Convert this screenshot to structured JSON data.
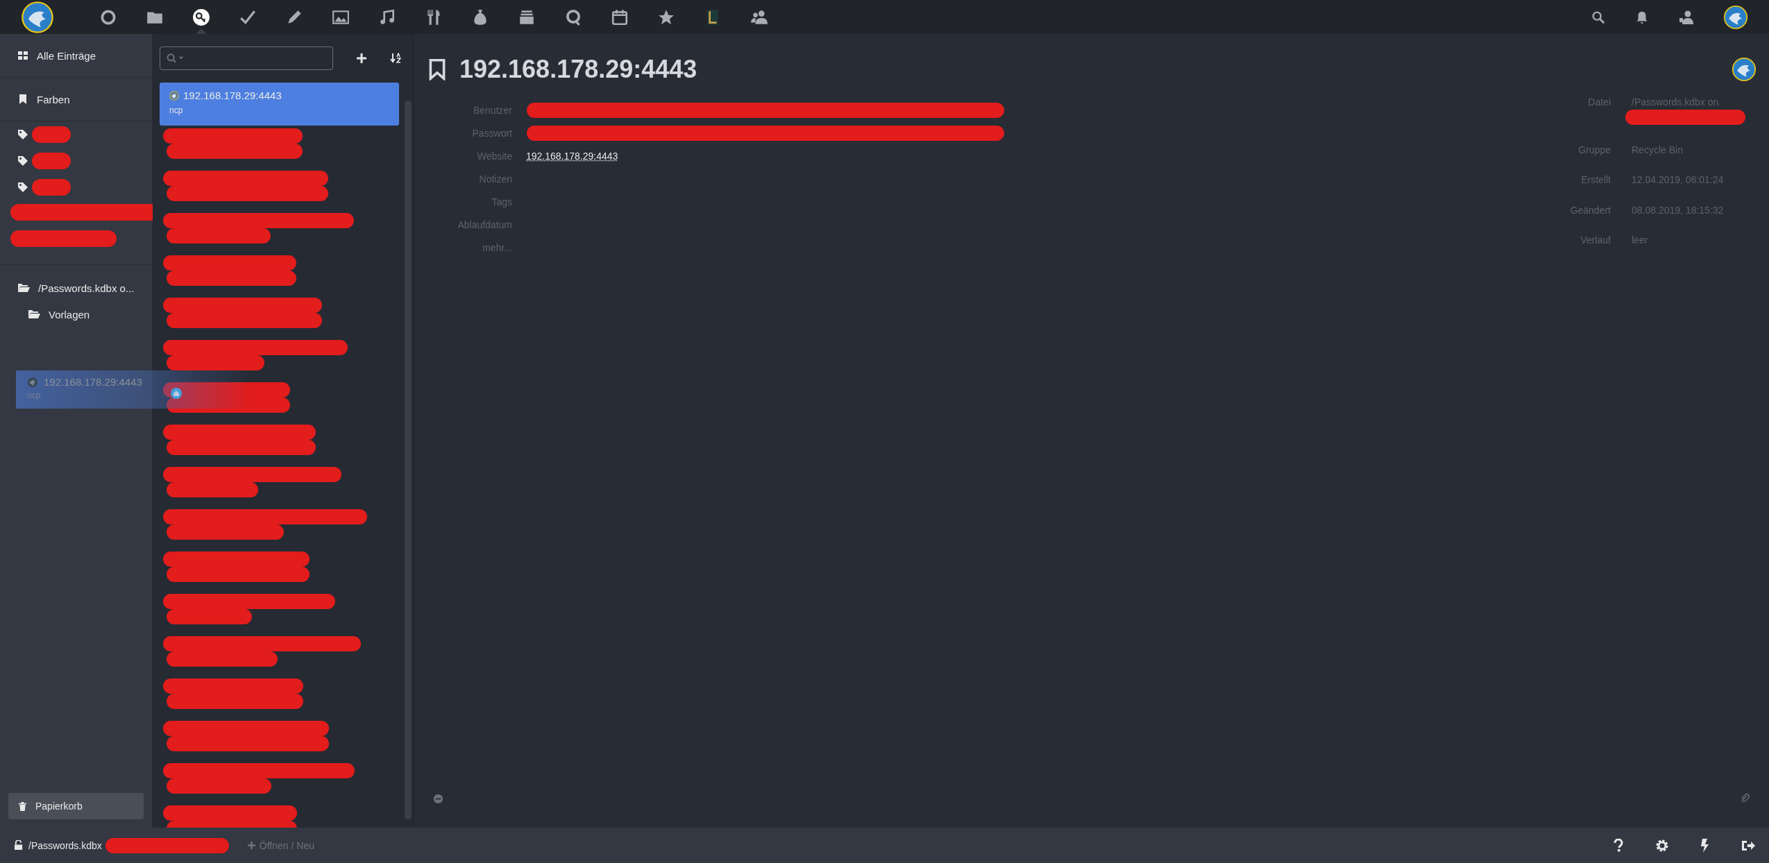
{
  "top_nav": [
    {
      "selected": false
    },
    {
      "selected": false
    },
    {
      "selected": true
    },
    {
      "selected": false
    },
    {
      "selected": false
    },
    {
      "selected": false
    },
    {
      "selected": false
    },
    {
      "selected": false
    },
    {
      "selected": false
    },
    {
      "selected": false
    },
    {
      "selected": false
    },
    {
      "selected": false
    },
    {
      "selected": false
    },
    {
      "selected": false
    },
    {
      "selected": false
    }
  ],
  "sidebar": {
    "items": [
      {
        "kind": "all",
        "label": "Alle Einträge"
      },
      {
        "kind": "colors",
        "label": "Farben"
      },
      {
        "kind": "tag-redacted"
      },
      {
        "kind": "tag-redacted"
      },
      {
        "kind": "tag-redacted"
      },
      {
        "kind": "redacted"
      },
      {
        "kind": "redacted"
      },
      {
        "kind": "folder",
        "label": "/Passwords.kdbx o..."
      },
      {
        "kind": "subfolder",
        "label": "Vorlagen"
      }
    ],
    "trash": "Papierkorb"
  },
  "drag_preview": {
    "title": "192.168.178.29:4443",
    "subtitle": "ncp"
  },
  "entries": [
    {
      "kind": "entry",
      "title": "192.168.178.29:4443",
      "subtitle": "ncp",
      "selected": true
    },
    {
      "kind": "redacted",
      "selected": false
    },
    {
      "kind": "redacted",
      "selected": false
    },
    {
      "kind": "redacted",
      "selected": false
    },
    {
      "kind": "redacted",
      "selected": false
    },
    {
      "kind": "redacted",
      "selected": false
    },
    {
      "kind": "redacted",
      "selected": false
    },
    {
      "kind": "redacted-icon",
      "selected": false
    },
    {
      "kind": "redacted",
      "selected": false
    },
    {
      "kind": "redacted",
      "selected": false
    },
    {
      "kind": "redacted",
      "selected": false
    },
    {
      "kind": "redacted",
      "selected": false
    },
    {
      "kind": "redacted",
      "selected": false
    },
    {
      "kind": "redacted",
      "selected": false
    },
    {
      "kind": "redacted",
      "selected": false
    },
    {
      "kind": "redacted",
      "selected": false
    },
    {
      "kind": "redacted",
      "selected": false
    },
    {
      "kind": "redacted",
      "selected": false
    }
  ],
  "detail": {
    "title": "192.168.178.29:4443",
    "fields": [
      {
        "label": "Benutzer",
        "redacted": true
      },
      {
        "label": "Passwort",
        "redacted": true
      },
      {
        "label": "Website",
        "value": "192.168.178.29:4443",
        "link": true
      },
      {
        "label": "Notizen"
      },
      {
        "label": "Tags"
      },
      {
        "label": "Ablaufdatum"
      },
      {
        "label": "mehr..."
      }
    ],
    "info": [
      {
        "label": "Datei",
        "value": "/Passwords.kdbx on",
        "redacted_line": true
      },
      {
        "label": "Gruppe",
        "value": "Recycle Bin"
      },
      {
        "label": "Erstellt",
        "value": "12.04.2019, 06:01:24"
      },
      {
        "label": "Geändert",
        "value": "08.08.2019, 18:15:32"
      },
      {
        "label": "Verlauf",
        "value": "leer"
      }
    ]
  },
  "status_bar": {
    "file": "/Passwords.kdbx",
    "open_new": "Öffnen / Neu"
  }
}
